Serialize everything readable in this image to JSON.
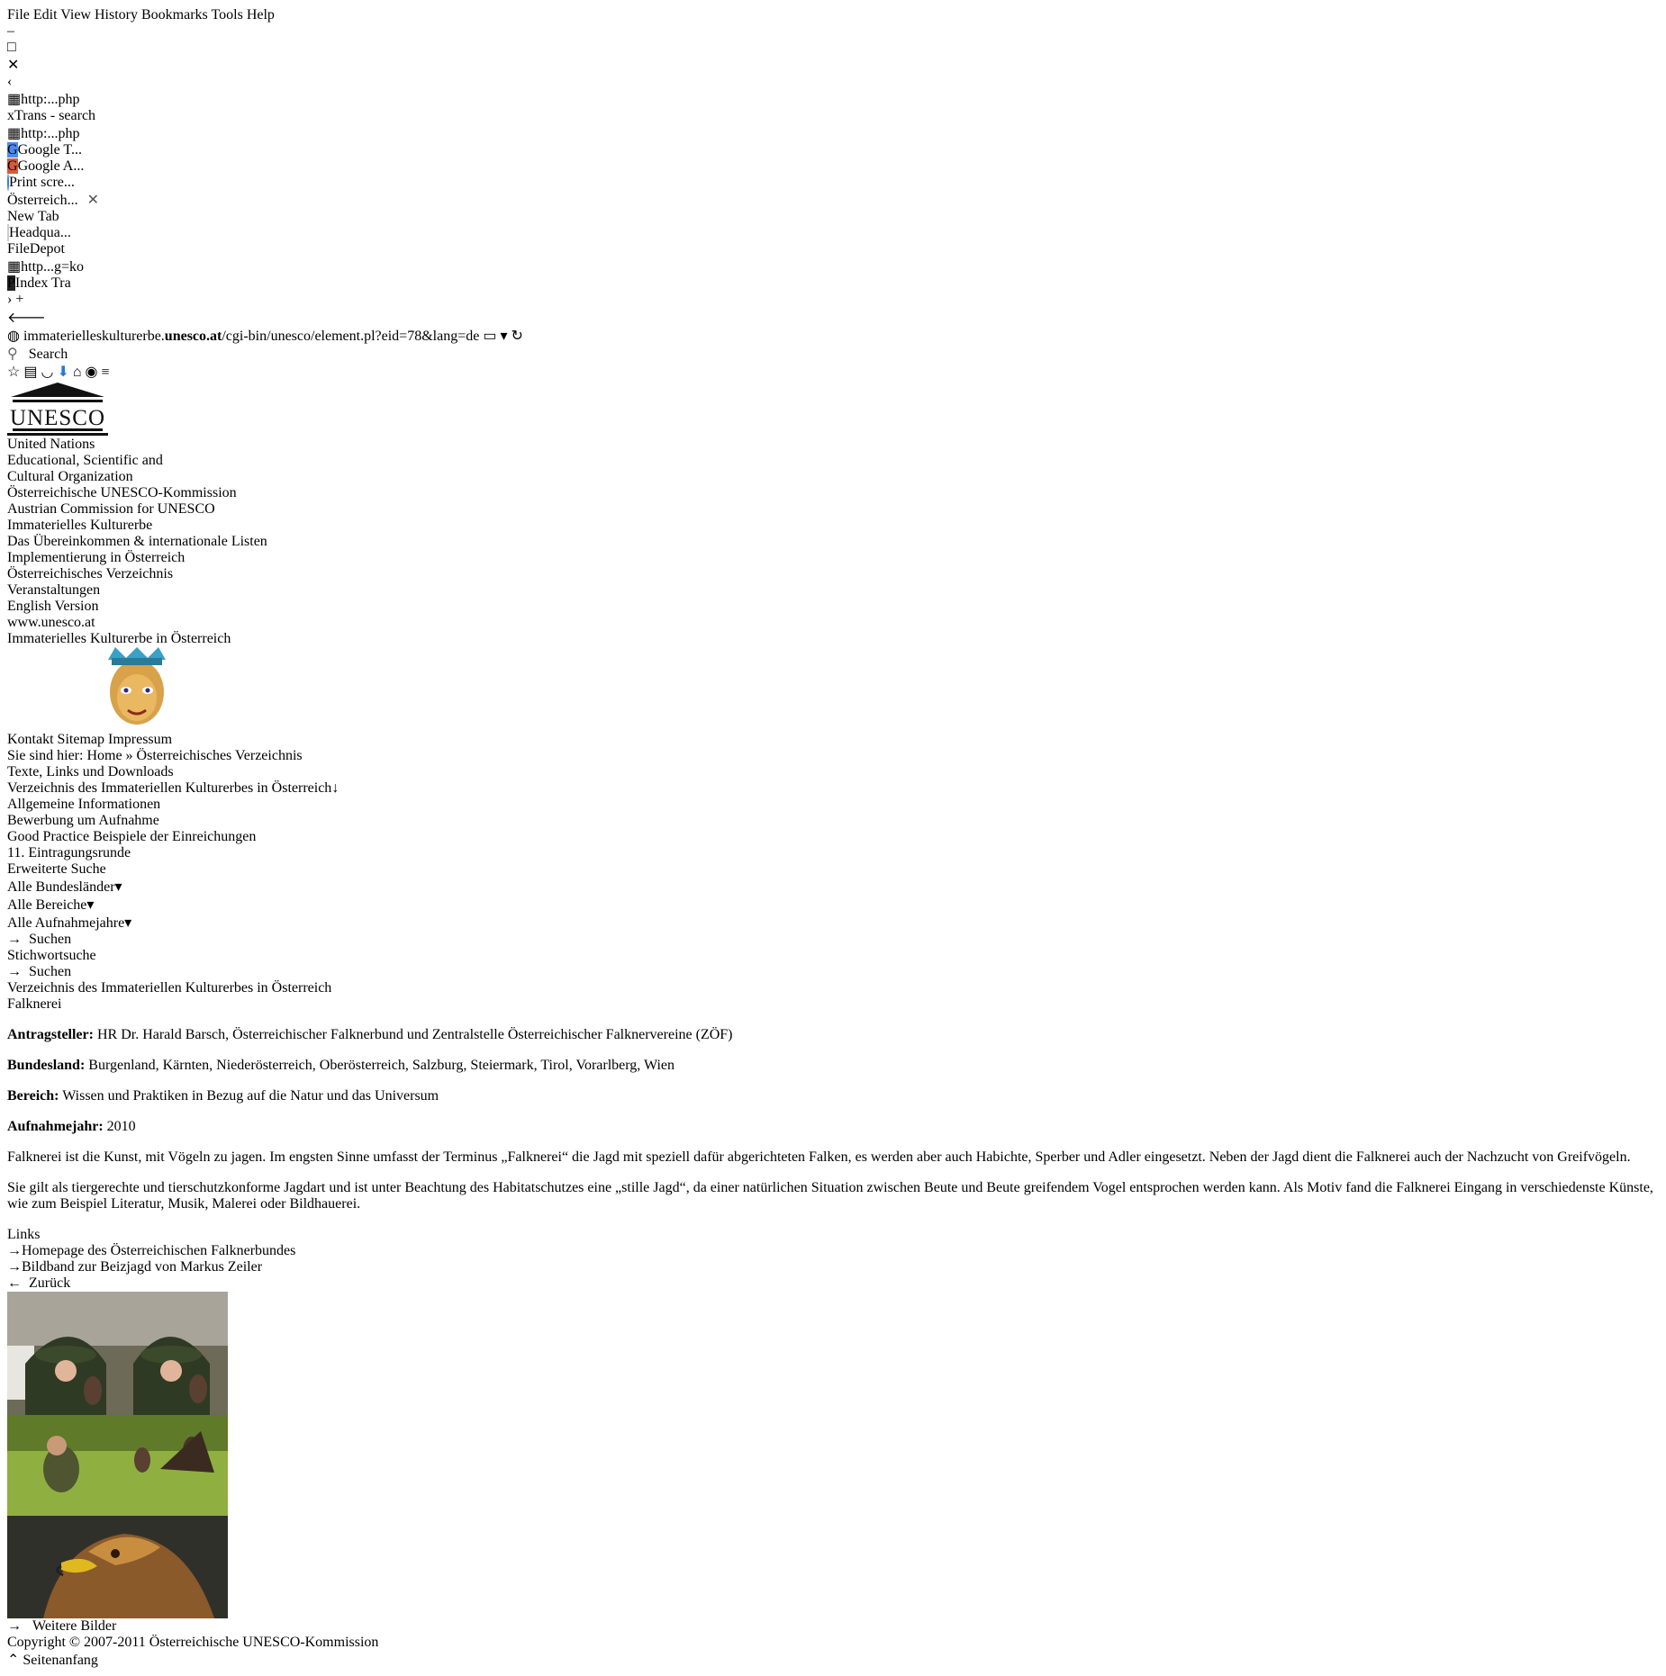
{
  "browser": {
    "menu": [
      "File",
      "Edit",
      "View",
      "History",
      "Bookmarks",
      "Tools",
      "Help"
    ],
    "tabs": [
      "http:...php",
      "xTrans - search",
      "http:...php",
      "Google T...",
      "Google A...",
      "Print scre...",
      "Österreich...",
      "New Tab",
      "Headqua...",
      "FileDepot",
      "http...g=ko",
      "Index Tra"
    ],
    "url_pre": "immaterielleskulturerbe.",
    "url_bold": "unesco.at",
    "url_post": "/cgi-bin/unesco/element.pl?eid=78&lang=de",
    "search_placeholder": "Search"
  },
  "site": {
    "un_line1": "United Nations",
    "un_line2": "Educational, Scientific and",
    "un_line3": "Cultural Organization",
    "commission_de": "Österreichische UNESCO-Kommission",
    "commission_en": "Austrian Commission for UNESCO",
    "nav": [
      "Immaterielles Kulturerbe",
      "Das Übereinkommen & internationale Listen",
      "Implementierung in Österreich",
      "Österreichisches Verzeichnis",
      "Veranstaltungen"
    ],
    "english_version": "English Version",
    "vertical_brand": "www.unesco.at",
    "banner_title": "Immaterielles Kulturerbe in Österreich",
    "top_links": [
      "Kontakt",
      "Sitemap",
      "Impressum"
    ],
    "crumb_prefix": "Sie sind hier:",
    "crumb_home": "Home",
    "crumb_current": "Österreichisches Verzeichnis",
    "downloads_heading": "Texte, Links und Downloads"
  },
  "sidebar": {
    "main_item": "Verzeichnis des Immateriellen Kulturerbes in Österreich",
    "sub_items": [
      "Allgemeine Informationen",
      "Bewerbung um Aufnahme",
      "Good Practice Beispiele der Einreichungen",
      "11. Eintragungsrunde"
    ],
    "adv_search": "Erweiterte Suche",
    "select_states": "Alle Bundesländer",
    "select_areas": "Alle Bereiche",
    "select_years": "Alle Aufnahmejahre",
    "search_link": "Suchen",
    "keyword_heading": "Stichwortsuche",
    "keyword_value": "",
    "search_link2": "Suchen"
  },
  "main": {
    "title": "Verzeichnis des Immateriellen Kulturerbes in Österreich",
    "subtitle": "Falknerei",
    "k1": "Antragsteller:",
    "v1": "HR Dr. Harald Barsch, Österreichischer Falknerbund und Zentralstelle Österreichischer Falknervereine (ZÖF)",
    "k2": "Bundesland:",
    "v2": "Burgenland, Kärnten, Niederösterreich, Oberösterreich, Salzburg, Steiermark, Tirol, Vorarlberg, Wien",
    "k3": "Bereich:",
    "v3": "Wissen und Praktiken in Bezug auf die Natur und das Universum",
    "k4": "Aufnahmejahr:",
    "v4": "2010",
    "intro": "Falknerei ist die Kunst, mit Vögeln zu jagen. Im engsten Sinne umfasst der Terminus „Falknerei“ die Jagd mit speziell dafür abgerichteten Falken, es werden aber auch Habichte, Sperber und Adler eingesetzt. Neben der Jagd dient die Falknerei auch der Nachzucht von Greifvögeln.",
    "body": "Sie gilt als tiergerechte und tierschutzkonforme Jagdart und ist unter Beachtung des Habitatschutzes eine „stille Jagd“, da einer natürlichen Situation zwischen Beute und Beute greifendem Vogel entsprochen werden kann. Als Motiv fand die Falknerei Eingang in verschiedenste Künste, wie zum Beispiel Literatur, Musik, Malerei oder Bildhauerei.",
    "links_heading": "Links",
    "links": [
      "Homepage des Österreichischen Falknerbundes",
      "Bildband zur Beizjagd von Markus Zeiler"
    ],
    "back": "Zurück"
  },
  "right": {
    "more_images": "Weitere Bilder"
  },
  "footer": {
    "copyright": "Copyright © 2007-2011 Österreichische UNESCO-Kommission",
    "top": "Seitenanfang"
  },
  "colors": {
    "green": "#1e9e2e",
    "red": "#b8322b",
    "orange": "#e97a1e",
    "yellow": "#f2c40f",
    "darkgreen": "#1e7a34",
    "purple": "#4d4f8e"
  }
}
